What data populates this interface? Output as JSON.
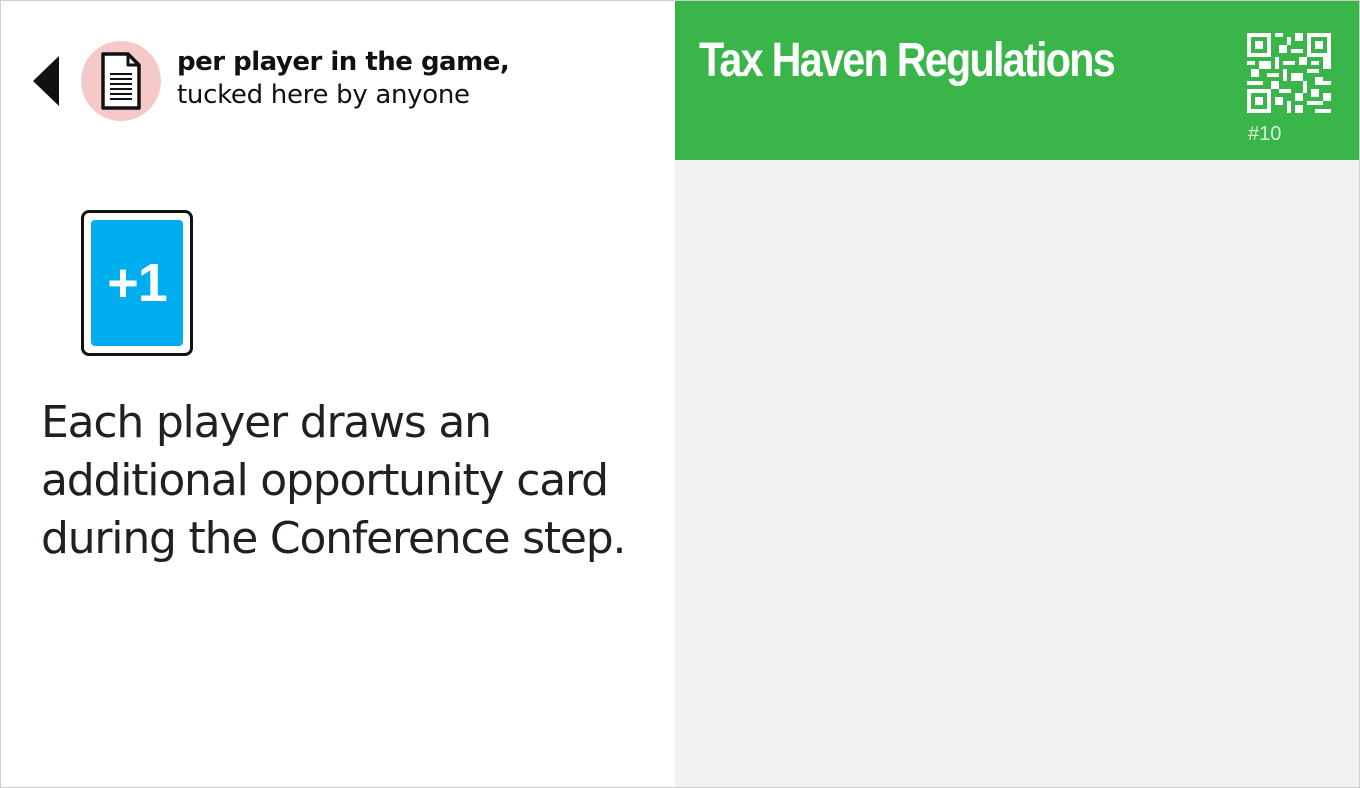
{
  "tuck_info": {
    "line1": "per player in the game,",
    "line2": "tucked here by anyone"
  },
  "bonus": {
    "label": "+1"
  },
  "effect": {
    "text": "Each player draws an additional opportunity card during the Conference step."
  },
  "card": {
    "title": "Tax Haven Regulations",
    "number": "#10"
  },
  "colors": {
    "title_bar": "#39b54a",
    "bonus_card": "#00aeef",
    "doc_badge": "#f6c9c9",
    "right_panel": "#f1f1f1"
  },
  "icons": [
    "back-arrow-icon",
    "document-icon",
    "qr-code-icon"
  ]
}
